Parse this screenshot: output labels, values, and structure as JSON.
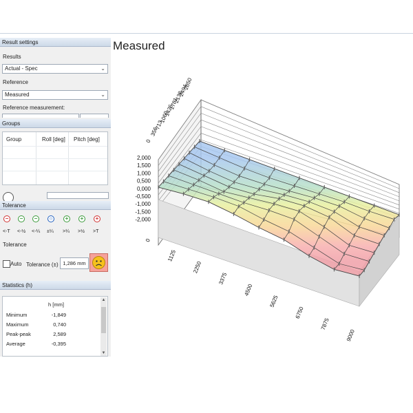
{
  "left_panel": {
    "result_settings": {
      "header": "Result settings",
      "results_label": "Results",
      "results_value": "Actual - Spec",
      "reference_label": "Reference",
      "reference_value": "Measured",
      "reference_measurement_label": "Reference measurement:"
    },
    "groups": {
      "header": "Groups",
      "columns": [
        "Group",
        "Roll [deg]",
        "Pitch [deg]"
      ]
    },
    "tolerance": {
      "header": "Tolerance",
      "items": [
        {
          "label": "<-T",
          "glyph": "−",
          "color": "#d03030"
        },
        {
          "label": "<-½",
          "glyph": "−",
          "color": "#3a9a3a"
        },
        {
          "label": "<-¼",
          "glyph": "−",
          "color": "#3a9a3a"
        },
        {
          "label": "±¼",
          "glyph": "○",
          "color": "#2060c0"
        },
        {
          "label": ">¼",
          "glyph": "+",
          "color": "#3a9a3a"
        },
        {
          "label": ">½",
          "glyph": "+",
          "color": "#3a9a3a"
        },
        {
          "label": ">T",
          "glyph": "+",
          "color": "#d03030"
        }
      ],
      "sub_label": "Tolerance",
      "auto_label": "Auto",
      "tolerance_field_label": "Tolerance (±)",
      "tolerance_value": "1,286 mm",
      "status_icon": "sad-face-icon"
    },
    "statistics": {
      "header": "Statistics (h)",
      "column": "h [mm]",
      "rows": [
        {
          "name": "Minimum",
          "value": "-1,849"
        },
        {
          "name": "Maximum",
          "value": "0,740"
        },
        {
          "name": "Peak-peak",
          "value": "2,589"
        },
        {
          "name": "Average",
          "value": "-0,395"
        }
      ]
    }
  },
  "main": {
    "title": "Measured",
    "z_ticks": [
      "2,000",
      "1,500",
      "1,000",
      "0,500",
      "0,000",
      "-0,500",
      "-1,000",
      "-1,500",
      "-2,000"
    ],
    "x_ticks": [
      "0",
      "1125",
      "2250",
      "3375",
      "4500",
      "5625",
      "6750",
      "7875",
      "9000"
    ],
    "y_ticks": [
      "0",
      "356",
      "713",
      "1069",
      "1425",
      "1781",
      "2138",
      "2494",
      "2850"
    ]
  },
  "colors": {
    "header_gradient_top": "#e6eef7",
    "header_gradient_bottom": "#cdd9e8",
    "status_face_bg": "#f6a29a"
  }
}
